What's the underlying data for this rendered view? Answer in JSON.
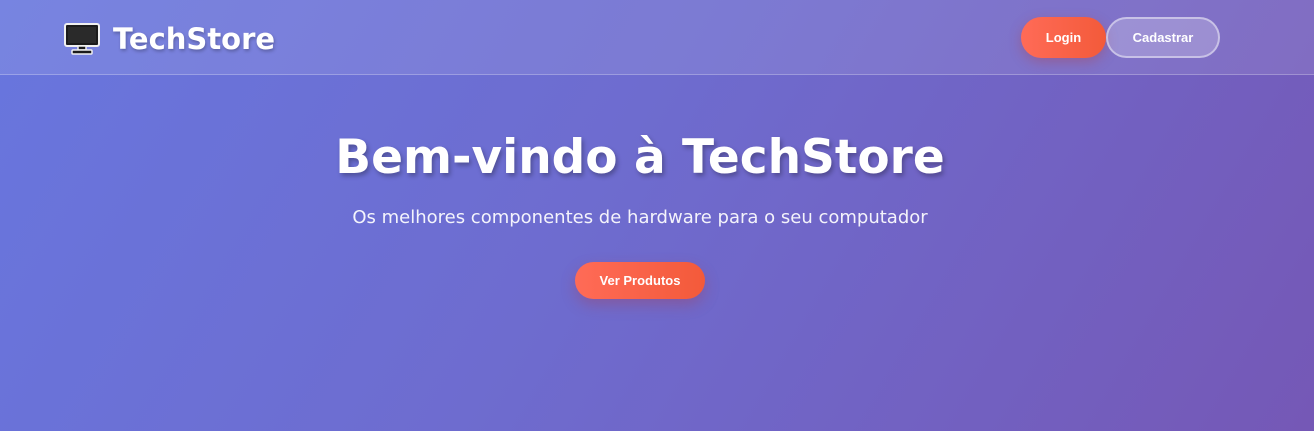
{
  "header": {
    "brand_name": "TechStore",
    "brand_icon": "monitor-icon",
    "login_label": "Login",
    "register_label": "Cadastrar"
  },
  "hero": {
    "title": "Bem-vindo à TechStore",
    "subtitle": "Os melhores componentes de hardware para o seu computador",
    "cta_label": "Ver Produtos"
  },
  "colors": {
    "background_start": "#6876de",
    "background_end": "#7558b6",
    "accent": "#f35a3a"
  }
}
